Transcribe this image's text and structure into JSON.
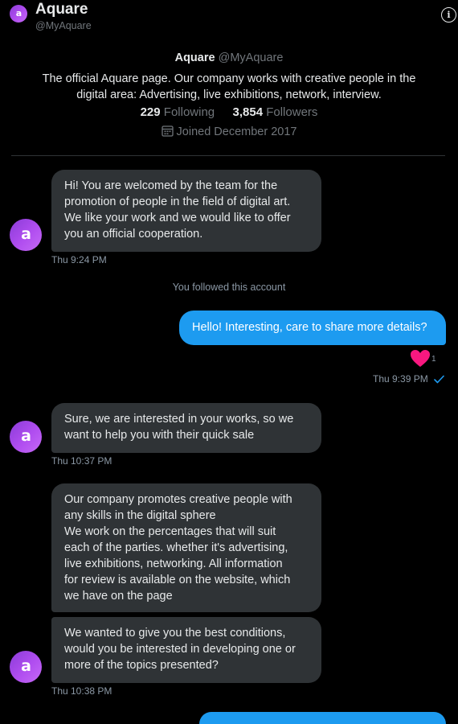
{
  "header": {
    "avatar_letter": "a",
    "name": "Aquare",
    "handle": "@MyAquare",
    "info_icon": "info-icon"
  },
  "profile": {
    "name": "Aquare",
    "handle": "@MyAquare",
    "bio_line1": "The official Aquare page. Our company works with creative people in the",
    "bio_line2": "digital area: Advertising, live exhibitions, network, interview.",
    "following_count": "229",
    "following_label": "Following",
    "followers_count": "3,854",
    "followers_label": "Followers",
    "joined": "Joined December 2017",
    "calendar_icon": "calendar-icon"
  },
  "messages": {
    "m1": {
      "lines": [
        "Hi! You are welcomed by the team for the",
        "promotion of people in the field of digital art.",
        "We like your work and we would like to offer",
        "you an official cooperation."
      ],
      "time": "Thu 9:24 PM"
    },
    "system_note": "You followed this account",
    "m2": {
      "text": "Hello! Interesting, care to share more details?",
      "reaction_icon": "heart-icon",
      "reaction_count": "1",
      "time": "Thu 9:39 PM",
      "status_icon": "checkmark-icon"
    },
    "m3": {
      "lines": [
        "Sure, we are interested in your works, so we",
        "want to help you with their quick sale"
      ],
      "time": "Thu 10:37 PM"
    },
    "m4": {
      "lines": [
        "Our company promotes creative people with",
        "any skills in the digital sphere",
        "We work on the percentages that will suit",
        "each of the parties. whether it's advertising,",
        "live exhibitions, networking. All information",
        "for review is available on the website, which",
        "we have on the page"
      ]
    },
    "m5": {
      "lines": [
        "We wanted to give you the best conditions,",
        "would you be interested in developing one or",
        "more of the topics presented?"
      ],
      "time": "Thu 10:38 PM"
    }
  },
  "colors": {
    "background": "#000000",
    "incoming_bubble": "#2f3336",
    "outgoing_bubble": "#1d9bf0",
    "heart": "#f91880",
    "avatar": "#a445e8"
  }
}
